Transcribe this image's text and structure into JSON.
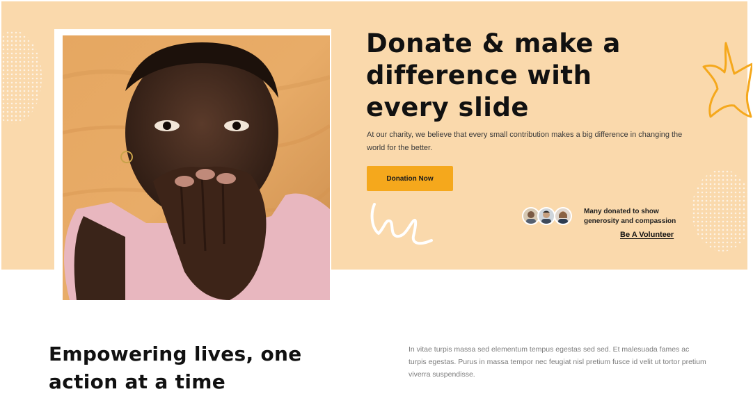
{
  "hero": {
    "title": "Donate & make a difference with every slide",
    "description": "At our charity, we believe that every small contribution makes a big difference in changing the world for the better.",
    "cta_label": "Donation Now",
    "donors_text": "Many donated to show generosity and compassion",
    "volunteer_link": "Be A Volunteer",
    "background_color": "#fad9ac",
    "accent_color": "#f5a81c"
  },
  "avatars": [
    {
      "name": "avatar-1"
    },
    {
      "name": "avatar-2"
    },
    {
      "name": "avatar-3"
    }
  ],
  "about": {
    "heading": "Empowering lives, one action at a time",
    "body": "In vitae turpis massa sed elementum tempus egestas sed sed. Et malesuada fames ac turpis egestas. Purus in massa tempor nec feugiat nisl pretium fusce id velit ut tortor pretium viverra suspendisse."
  },
  "icons": {
    "star_doodle": "star-doodle-icon",
    "signature": "signature-doodle"
  }
}
